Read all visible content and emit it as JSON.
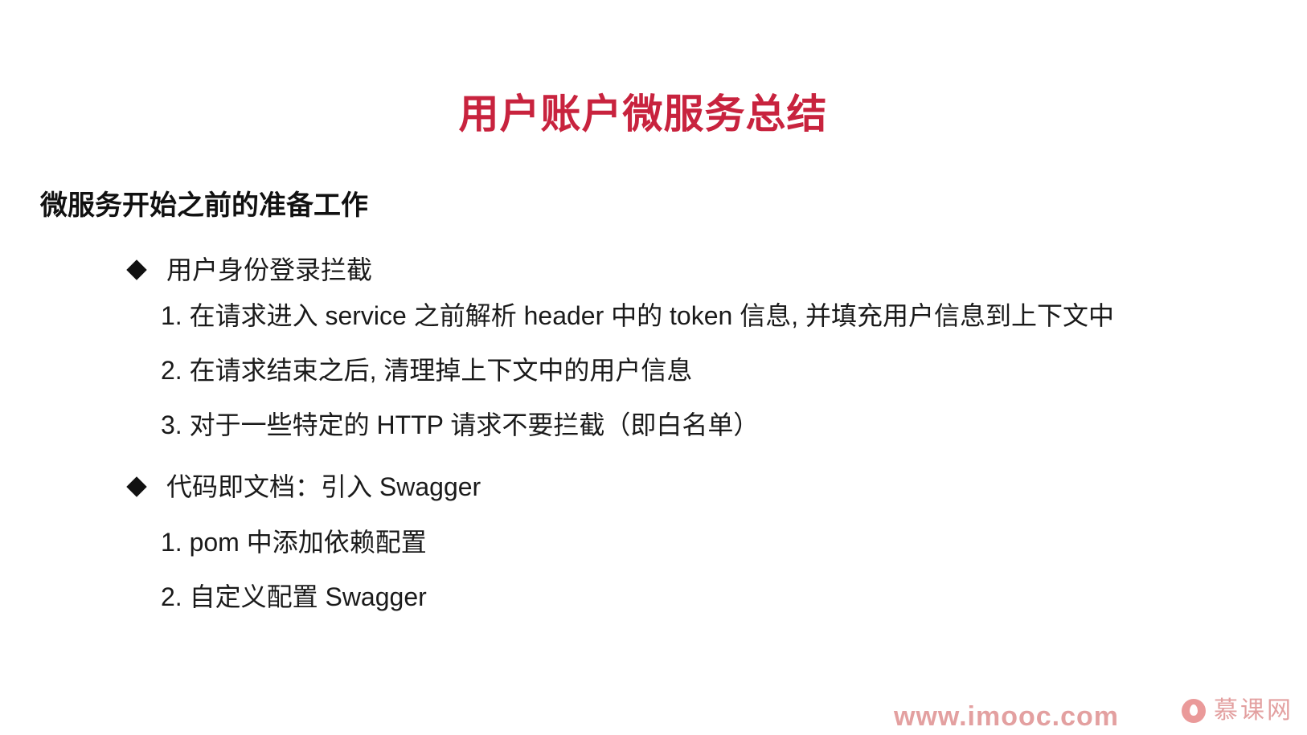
{
  "slide": {
    "title": "用户账户微服务总结",
    "section_heading": "微服务开始之前的准备工作",
    "bullets": [
      {
        "label": "用户身份登录拦截",
        "items": [
          "1. 在请求进入 service 之前解析 header 中的 token 信息, 并填充用户信息到上下文中",
          "2. 在请求结束之后, 清理掉上下文中的用户信息",
          "3. 对于一些特定的 HTTP 请求不要拦截（即白名单）"
        ]
      },
      {
        "label": "代码即文档：引入 Swagger",
        "items": [
          "1. pom 中添加依赖配置",
          "2. 自定义配置 Swagger"
        ]
      }
    ]
  },
  "watermark": {
    "url": "www.imooc.com",
    "brand": "慕课网"
  },
  "colors": {
    "title": "#c8233e",
    "watermark": "#e3a0a0"
  },
  "icons": {
    "bullet": "diamond-bullet-icon",
    "brand": "imooc-flame-logo-icon"
  }
}
